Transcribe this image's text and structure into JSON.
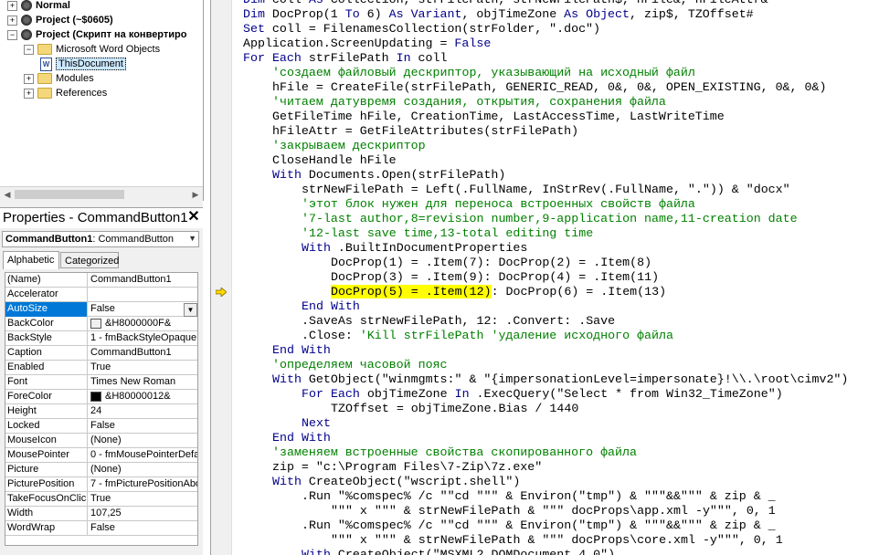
{
  "project_tree": {
    "nodes": [
      {
        "label": "Normal",
        "bold": true,
        "level": 0,
        "icon": "project-icon",
        "expander": "+"
      },
      {
        "label": "Project (~$0605)",
        "bold": true,
        "level": 0,
        "icon": "project-icon",
        "expander": "+"
      },
      {
        "label": "Project (Скрипт на конвертиро",
        "bold": true,
        "level": 0,
        "icon": "project-icon",
        "expander": "−"
      },
      {
        "label": "Microsoft Word Objects",
        "bold": false,
        "level": 1,
        "icon": "folder-icon",
        "expander": "−"
      },
      {
        "label": "ThisDocument",
        "bold": false,
        "level": 2,
        "icon": "document-icon",
        "expander": "",
        "selected": true
      },
      {
        "label": "Modules",
        "bold": false,
        "level": 1,
        "icon": "folder-icon",
        "expander": "+"
      },
      {
        "label": "References",
        "bold": false,
        "level": 1,
        "icon": "folder-icon",
        "expander": "+"
      }
    ]
  },
  "properties": {
    "title": "Properties - CommandButton1",
    "close_glyph": "✕",
    "object_selector": "CommandButton1 CommandButton",
    "object_name": "CommandButton1",
    "object_type": "CommandButton",
    "tabs": [
      "Alphabetic",
      "Categorized"
    ],
    "rows": [
      {
        "name": "(Name)",
        "value": "CommandButton1"
      },
      {
        "name": "Accelerator",
        "value": ""
      },
      {
        "name": "AutoSize",
        "value": "False",
        "selected": true,
        "dropdown": true
      },
      {
        "name": "BackColor",
        "value": "&H8000000F&",
        "swatch": "#f0f0f0"
      },
      {
        "name": "BackStyle",
        "value": "1 - fmBackStyleOpaque"
      },
      {
        "name": "Caption",
        "value": "CommandButton1"
      },
      {
        "name": "Enabled",
        "value": "True"
      },
      {
        "name": "Font",
        "value": "Times New Roman"
      },
      {
        "name": "ForeColor",
        "value": "&H80000012&",
        "swatch": "#000000"
      },
      {
        "name": "Height",
        "value": "24"
      },
      {
        "name": "Locked",
        "value": "False"
      },
      {
        "name": "MouseIcon",
        "value": "(None)"
      },
      {
        "name": "MousePointer",
        "value": "0 - fmMousePointerDefau"
      },
      {
        "name": "Picture",
        "value": "(None)"
      },
      {
        "name": "PicturePosition",
        "value": "7 - fmPicturePositionAbo"
      },
      {
        "name": "TakeFocusOnClick",
        "value": "True"
      },
      {
        "name": "Width",
        "value": "107,25"
      },
      {
        "name": "WordWrap",
        "value": "False"
      }
    ]
  },
  "colors": {
    "keyword": "#00008b",
    "comment": "#008000",
    "highlight": "#ffff00",
    "selection": "#0078d7",
    "exec_arrow": "#ffd800"
  },
  "code_lines": [
    {
      "indent": 1,
      "tokens": [
        {
          "t": "Dim",
          "k": 1
        },
        {
          "t": " coll "
        },
        {
          "t": "As",
          "k": 1
        },
        {
          "t": " Collection, strFilePath, strNewFilePath$, hFile&, hFileAttr&"
        }
      ]
    },
    {
      "indent": 1,
      "tokens": [
        {
          "t": "Dim",
          "k": 1
        },
        {
          "t": " DocProp(1 "
        },
        {
          "t": "To",
          "k": 1
        },
        {
          "t": " 6) "
        },
        {
          "t": "As",
          "k": 1
        },
        {
          "t": " "
        },
        {
          "t": "Variant",
          "k": 1
        },
        {
          "t": ", objTimeZone "
        },
        {
          "t": "As",
          "k": 1
        },
        {
          "t": " "
        },
        {
          "t": "Object",
          "k": 1
        },
        {
          "t": ", zip$, TZOffset#"
        }
      ]
    },
    {
      "indent": 1,
      "tokens": [
        {
          "t": "Set",
          "k": 1
        },
        {
          "t": " coll = FilenamesCollection(strFolder, \".doc\")"
        }
      ]
    },
    {
      "indent": 1,
      "tokens": [
        {
          "t": "Application.ScreenUpdating = "
        },
        {
          "t": "False",
          "k": 1
        }
      ]
    },
    {
      "indent": 1,
      "tokens": [
        {
          "t": "For",
          "k": 1
        },
        {
          "t": " "
        },
        {
          "t": "Each",
          "k": 1
        },
        {
          "t": " strFilePath "
        },
        {
          "t": "In",
          "k": 1
        },
        {
          "t": " coll"
        }
      ]
    },
    {
      "indent": 2,
      "tokens": [
        {
          "t": "'создаем файловый дескриптор, указывающий на исходный файл",
          "c": 1
        }
      ]
    },
    {
      "indent": 2,
      "tokens": [
        {
          "t": "hFile = CreateFile(strFilePath, GENERIC_READ, 0&, 0&, OPEN_EXISTING, 0&, 0&)"
        }
      ]
    },
    {
      "indent": 2,
      "tokens": [
        {
          "t": "'читаем датувремя создания, открытия, сохранения файла",
          "c": 1
        }
      ]
    },
    {
      "indent": 2,
      "tokens": [
        {
          "t": "GetFileTime hFile, CreationTime, LastAccessTime, LastWriteTime"
        }
      ]
    },
    {
      "indent": 2,
      "tokens": [
        {
          "t": "hFileAttr = GetFileAttributes(strFilePath)"
        }
      ]
    },
    {
      "indent": 2,
      "tokens": [
        {
          "t": "'закрываем дескриптор",
          "c": 1
        }
      ]
    },
    {
      "indent": 2,
      "tokens": [
        {
          "t": "CloseHandle hFile"
        }
      ]
    },
    {
      "indent": 2,
      "tokens": [
        {
          "t": "With",
          "k": 1
        },
        {
          "t": " Documents.Open(strFilePath)"
        }
      ]
    },
    {
      "indent": 3,
      "tokens": [
        {
          "t": "strNewFilePath = Left(.FullName, InStrRev(.FullName, \".\")) & \"docx\""
        }
      ]
    },
    {
      "indent": 3,
      "tokens": [
        {
          "t": "'этот блок нужен для переноса встроенных свойств файла",
          "c": 1
        }
      ]
    },
    {
      "indent": 3,
      "tokens": [
        {
          "t": "'7-last author,8=revision number,9-application name,11-creation date",
          "c": 1
        }
      ]
    },
    {
      "indent": 3,
      "tokens": [
        {
          "t": "'12-last save time,13-total editing time",
          "c": 1
        }
      ]
    },
    {
      "indent": 3,
      "tokens": [
        {
          "t": "With",
          "k": 1
        },
        {
          "t": " .BuiltInDocumentProperties"
        }
      ]
    },
    {
      "indent": 4,
      "tokens": [
        {
          "t": "DocProp(1) = .Item(7): DocProp(2) = .Item(8)"
        }
      ]
    },
    {
      "indent": 4,
      "tokens": [
        {
          "t": "DocProp(3) = .Item(9): DocProp(4) = .Item(11)"
        }
      ]
    },
    {
      "indent": 4,
      "tokens": [
        {
          "t": "DocProp(5) = .Item(12)",
          "h": 1
        },
        {
          "t": ": DocProp(6) = .Item(13)"
        }
      ]
    },
    {
      "indent": 3,
      "tokens": [
        {
          "t": "End",
          "k": 1
        },
        {
          "t": " "
        },
        {
          "t": "With",
          "k": 1
        }
      ]
    },
    {
      "indent": 3,
      "tokens": [
        {
          "t": ".SaveAs strNewFilePath, 12: .Convert: .Save"
        }
      ]
    },
    {
      "indent": 3,
      "tokens": [
        {
          "t": ".Close: "
        },
        {
          "t": "'Kill strFilePath 'удаление исходного файла",
          "c": 1
        }
      ]
    },
    {
      "indent": 2,
      "tokens": [
        {
          "t": "End",
          "k": 1
        },
        {
          "t": " "
        },
        {
          "t": "With",
          "k": 1
        }
      ]
    },
    {
      "indent": 2,
      "tokens": [
        {
          "t": "'определяем часовой пояс",
          "c": 1
        }
      ]
    },
    {
      "indent": 2,
      "tokens": [
        {
          "t": "With",
          "k": 1
        },
        {
          "t": " GetObject(\"winmgmts:\" & \"{impersonationLevel=impersonate}!\\\\.\\root\\cimv2\")"
        }
      ]
    },
    {
      "indent": 3,
      "tokens": [
        {
          "t": "For",
          "k": 1
        },
        {
          "t": " "
        },
        {
          "t": "Each",
          "k": 1
        },
        {
          "t": " objTimeZone "
        },
        {
          "t": "In",
          "k": 1
        },
        {
          "t": " .ExecQuery(\"Select * from Win32_TimeZone\")"
        }
      ]
    },
    {
      "indent": 4,
      "tokens": [
        {
          "t": "TZOffset = objTimeZone.Bias / 1440"
        }
      ]
    },
    {
      "indent": 3,
      "tokens": [
        {
          "t": "Next",
          "k": 1
        }
      ]
    },
    {
      "indent": 2,
      "tokens": [
        {
          "t": "End",
          "k": 1
        },
        {
          "t": " "
        },
        {
          "t": "With",
          "k": 1
        }
      ]
    },
    {
      "indent": 2,
      "tokens": [
        {
          "t": "'заменяем встроенные свойства скопированного файла",
          "c": 1
        }
      ]
    },
    {
      "indent": 2,
      "tokens": [
        {
          "t": "zip = \"c:\\Program Files\\7-Zip\\7z.exe\""
        }
      ]
    },
    {
      "indent": 2,
      "tokens": [
        {
          "t": "With",
          "k": 1
        },
        {
          "t": " CreateObject(\"wscript.shell\")"
        }
      ]
    },
    {
      "indent": 3,
      "tokens": [
        {
          "t": ".Run \"%comspec% /c \"\"cd \"\"\" & Environ(\"tmp\") & \"\"\"&&\"\"\" & zip & _"
        }
      ]
    },
    {
      "indent": 4,
      "tokens": [
        {
          "t": "\"\"\" x \"\"\" & strNewFilePath & \"\"\" docProps\\app.xml -y\"\"\", 0, 1"
        }
      ]
    },
    {
      "indent": 3,
      "tokens": [
        {
          "t": ".Run \"%comspec% /c \"\"cd \"\"\" & Environ(\"tmp\") & \"\"\"&&\"\"\" & zip & _"
        }
      ]
    },
    {
      "indent": 4,
      "tokens": [
        {
          "t": "\"\"\" x \"\"\" & strNewFilePath & \"\"\" docProps\\core.xml -y\"\"\", 0, 1"
        }
      ]
    },
    {
      "indent": 3,
      "tokens": [
        {
          "t": "With",
          "k": 1
        },
        {
          "t": " CreateObject(\"MSXML2.DOMDocument.4.0\")"
        }
      ]
    }
  ]
}
